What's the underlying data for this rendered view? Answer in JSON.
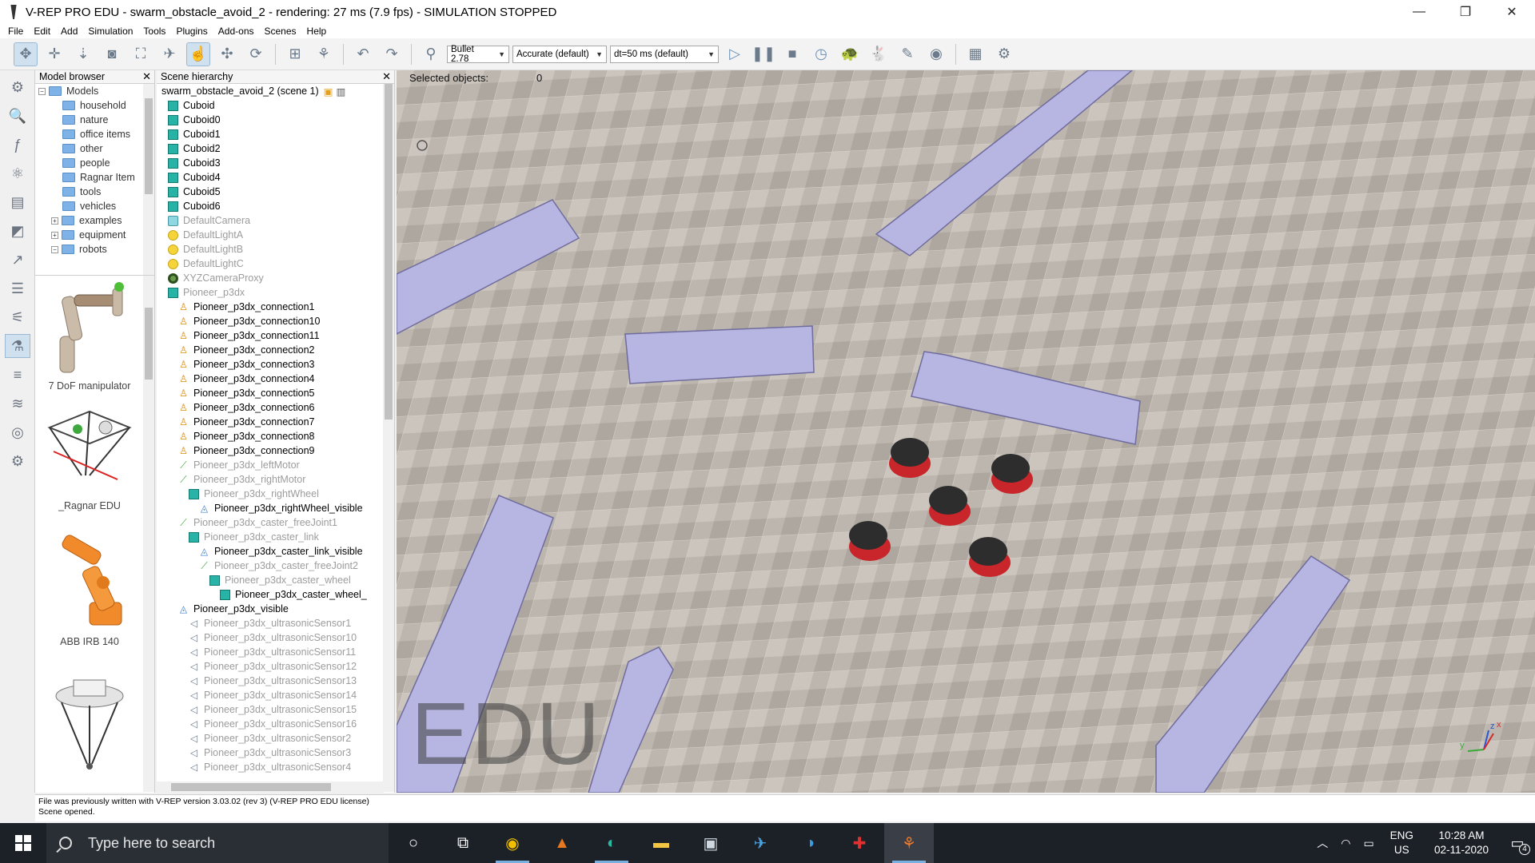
{
  "window": {
    "title": "V-REP PRO EDU - swarm_obstacle_avoid_2 - rendering: 27 ms (7.9 fps) - SIMULATION STOPPED",
    "minimize": "—",
    "restore": "❐",
    "close": "✕"
  },
  "menu": [
    "File",
    "Edit",
    "Add",
    "Simulation",
    "Tools",
    "Plugins",
    "Add-ons",
    "Scenes",
    "Help"
  ],
  "toolbar": {
    "engine": "Bullet 2.78",
    "accuracy": "Accurate (default)",
    "timestep": "dt=50 ms (default)"
  },
  "model_browser": {
    "title": "Model browser",
    "close": "✕",
    "tree": [
      {
        "label": "Models",
        "level": 0,
        "expander": "−"
      },
      {
        "label": "household",
        "level": 1
      },
      {
        "label": "nature",
        "level": 1
      },
      {
        "label": "office items",
        "level": 1
      },
      {
        "label": "other",
        "level": 1
      },
      {
        "label": "people",
        "level": 1
      },
      {
        "label": "Ragnar Item",
        "level": 1
      },
      {
        "label": "tools",
        "level": 1
      },
      {
        "label": "vehicles",
        "level": 1
      },
      {
        "label": "examples",
        "level": 1,
        "expander": "+"
      },
      {
        "label": "equipment",
        "level": 1,
        "expander": "+"
      },
      {
        "label": "robots",
        "level": 1,
        "expander": "−"
      }
    ],
    "models": [
      {
        "label": "7 DoF manipulator"
      },
      {
        "label": "_Ragnar EDU"
      },
      {
        "label": "ABB IRB 140"
      },
      {
        "label": ""
      }
    ]
  },
  "hierarchy": {
    "title": "Scene hierarchy",
    "close": "✕",
    "scene": "swarm_obstacle_avoid_2 (scene 1)",
    "rows": [
      {
        "label": "Cuboid",
        "icon": "cube",
        "indent": 0,
        "dim": false
      },
      {
        "label": "Cuboid0",
        "icon": "cube",
        "indent": 0,
        "dim": false
      },
      {
        "label": "Cuboid1",
        "icon": "cube",
        "indent": 0,
        "dim": false
      },
      {
        "label": "Cuboid2",
        "icon": "cube",
        "indent": 0,
        "dim": false
      },
      {
        "label": "Cuboid3",
        "icon": "cube",
        "indent": 0,
        "dim": false
      },
      {
        "label": "Cuboid4",
        "icon": "cube",
        "indent": 0,
        "dim": false
      },
      {
        "label": "Cuboid5",
        "icon": "cube",
        "indent": 0,
        "dim": false
      },
      {
        "label": "Cuboid6",
        "icon": "cube",
        "indent": 0,
        "dim": false
      },
      {
        "label": "DefaultCamera",
        "icon": "cam",
        "indent": 0,
        "dim": true
      },
      {
        "label": "DefaultLightA",
        "icon": "light",
        "indent": 0,
        "dim": true
      },
      {
        "label": "DefaultLightB",
        "icon": "light",
        "indent": 0,
        "dim": true
      },
      {
        "label": "DefaultLightC",
        "icon": "light",
        "indent": 0,
        "dim": true
      },
      {
        "label": "XYZCameraProxy",
        "icon": "dummy",
        "indent": 0,
        "dim": true
      },
      {
        "label": "Pioneer_p3dx",
        "icon": "cube",
        "indent": 0,
        "dim": true
      },
      {
        "label": "Pioneer_p3dx_connection1",
        "icon": "joint",
        "indent": 1,
        "dim": false
      },
      {
        "label": "Pioneer_p3dx_connection10",
        "icon": "joint",
        "indent": 1,
        "dim": false
      },
      {
        "label": "Pioneer_p3dx_connection11",
        "icon": "joint",
        "indent": 1,
        "dim": false
      },
      {
        "label": "Pioneer_p3dx_connection2",
        "icon": "joint",
        "indent": 1,
        "dim": false
      },
      {
        "label": "Pioneer_p3dx_connection3",
        "icon": "joint",
        "indent": 1,
        "dim": false
      },
      {
        "label": "Pioneer_p3dx_connection4",
        "icon": "joint",
        "indent": 1,
        "dim": false
      },
      {
        "label": "Pioneer_p3dx_connection5",
        "icon": "joint",
        "indent": 1,
        "dim": false
      },
      {
        "label": "Pioneer_p3dx_connection6",
        "icon": "joint",
        "indent": 1,
        "dim": false
      },
      {
        "label": "Pioneer_p3dx_connection7",
        "icon": "joint",
        "indent": 1,
        "dim": false
      },
      {
        "label": "Pioneer_p3dx_connection8",
        "icon": "joint",
        "indent": 1,
        "dim": false
      },
      {
        "label": "Pioneer_p3dx_connection9",
        "icon": "joint",
        "indent": 1,
        "dim": false
      },
      {
        "label": "Pioneer_p3dx_leftMotor",
        "icon": "joint2",
        "indent": 1,
        "dim": true
      },
      {
        "label": "Pioneer_p3dx_rightMotor",
        "icon": "joint2",
        "indent": 1,
        "dim": true
      },
      {
        "label": "Pioneer_p3dx_rightWheel",
        "icon": "cube",
        "indent": 2,
        "dim": true
      },
      {
        "label": "Pioneer_p3dx_rightWheel_visible",
        "icon": "shape",
        "indent": 3,
        "dim": false
      },
      {
        "label": "Pioneer_p3dx_caster_freeJoint1",
        "icon": "joint2",
        "indent": 1,
        "dim": true
      },
      {
        "label": "Pioneer_p3dx_caster_link",
        "icon": "cube",
        "indent": 2,
        "dim": true
      },
      {
        "label": "Pioneer_p3dx_caster_link_visible",
        "icon": "shape",
        "indent": 3,
        "dim": false
      },
      {
        "label": "Pioneer_p3dx_caster_freeJoint2",
        "icon": "joint2",
        "indent": 3,
        "dim": true
      },
      {
        "label": "Pioneer_p3dx_caster_wheel",
        "icon": "cube",
        "indent": 4,
        "dim": true
      },
      {
        "label": "Pioneer_p3dx_caster_wheel_",
        "icon": "cube",
        "indent": 5,
        "dim": false
      },
      {
        "label": "Pioneer_p3dx_visible",
        "icon": "shape",
        "indent": 1,
        "dim": false
      },
      {
        "label": "Pioneer_p3dx_ultrasonicSensor1",
        "icon": "sensor",
        "indent": 2,
        "dim": true
      },
      {
        "label": "Pioneer_p3dx_ultrasonicSensor10",
        "icon": "sensor",
        "indent": 2,
        "dim": true
      },
      {
        "label": "Pioneer_p3dx_ultrasonicSensor11",
        "icon": "sensor",
        "indent": 2,
        "dim": true
      },
      {
        "label": "Pioneer_p3dx_ultrasonicSensor12",
        "icon": "sensor",
        "indent": 2,
        "dim": true
      },
      {
        "label": "Pioneer_p3dx_ultrasonicSensor13",
        "icon": "sensor",
        "indent": 2,
        "dim": true
      },
      {
        "label": "Pioneer_p3dx_ultrasonicSensor14",
        "icon": "sensor",
        "indent": 2,
        "dim": true
      },
      {
        "label": "Pioneer_p3dx_ultrasonicSensor15",
        "icon": "sensor",
        "indent": 2,
        "dim": true
      },
      {
        "label": "Pioneer_p3dx_ultrasonicSensor16",
        "icon": "sensor",
        "indent": 2,
        "dim": true
      },
      {
        "label": "Pioneer_p3dx_ultrasonicSensor2",
        "icon": "sensor",
        "indent": 2,
        "dim": true
      },
      {
        "label": "Pioneer_p3dx_ultrasonicSensor3",
        "icon": "sensor",
        "indent": 2,
        "dim": true
      },
      {
        "label": "Pioneer_p3dx_ultrasonicSensor4",
        "icon": "sensor",
        "indent": 2,
        "dim": true
      }
    ]
  },
  "viewport": {
    "selected_label": "Selected objects:",
    "selected_count": "0",
    "watermark": "EDU",
    "floor_color": "#b9b2ab",
    "wall_color": "#b7b5e2",
    "robot_color": "#c8262b",
    "axis_labels": {
      "x": "x",
      "y": "y",
      "z": "z"
    }
  },
  "status": {
    "line1": "File was previously written with V-REP version 3.03.02 (rev 3) (V-REP PRO EDU license)",
    "line2": "Scene opened."
  },
  "taskbar": {
    "search_placeholder": "Type here to search",
    "lang_top": "ENG",
    "lang_bottom": "US",
    "time": "10:28 AM",
    "date": "02-11-2020",
    "notifications": "4"
  }
}
